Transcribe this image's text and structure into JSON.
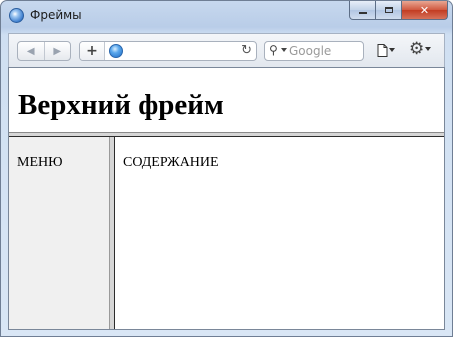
{
  "window": {
    "title": "Фреймы",
    "icon": "browser-globe-icon",
    "buttons": {
      "minimize": "minimize-icon",
      "maximize": "maximize-icon",
      "close": "close-icon"
    }
  },
  "toolbar": {
    "back_icon": "back-arrow-icon",
    "forward_icon": "forward-arrow-icon",
    "add_icon": "plus-icon",
    "address": {
      "value": "",
      "icon": "globe-icon"
    },
    "reload_icon": "reload-icon",
    "search": {
      "placeholder": "Google",
      "icon": "search-icon"
    },
    "page_menu_icon": "page-icon",
    "settings_icon": "gear-icon"
  },
  "frames": {
    "top": {
      "heading": "Верхний фрейм"
    },
    "menu": {
      "text": "МЕНЮ"
    },
    "content": {
      "text": "СОДЕРЖАНИЕ"
    }
  }
}
